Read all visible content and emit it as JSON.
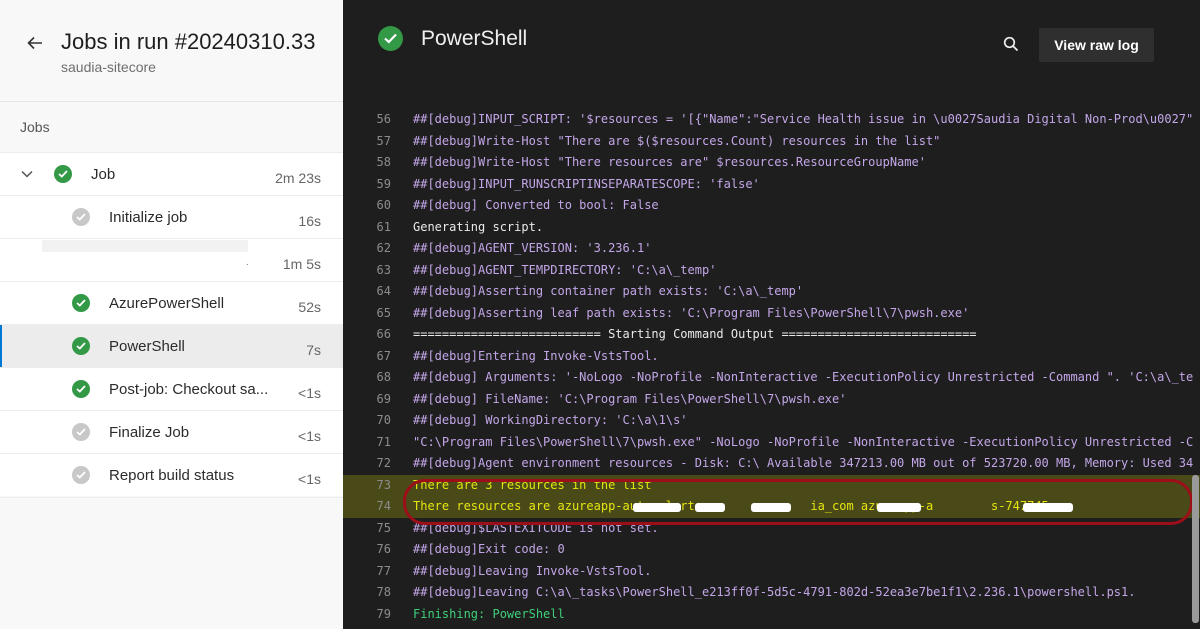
{
  "header": {
    "title": "Jobs in run #20240310.33",
    "subtitle": "saudia-sitecore",
    "back_icon": "arrow-left-icon"
  },
  "jobs_label": "Jobs",
  "jobs": [
    {
      "label": "Job",
      "duration": "2m 23s",
      "status": "success",
      "expanded": true
    },
    {
      "label": "Initialize job",
      "duration": "16s",
      "status": "pending"
    },
    {
      "label": "",
      "duration": "1m 5s",
      "status": "none"
    },
    {
      "label": "AzurePowerShell",
      "duration": "52s",
      "status": "success"
    },
    {
      "label": "PowerShell",
      "duration": "7s",
      "status": "success",
      "selected": true
    },
    {
      "label": "Post-job: Checkout sa...",
      "duration": "<1s",
      "status": "success"
    },
    {
      "label": "Finalize Job",
      "duration": "<1s",
      "status": "pending"
    },
    {
      "label": "Report build status",
      "duration": "<1s",
      "status": "pending"
    }
  ],
  "detail": {
    "title": "PowerShell",
    "status": "success",
    "search_icon": "search-icon",
    "view_raw_label": "View raw log"
  },
  "log_lines": [
    {
      "n": "56",
      "t": "##[debug]INPUT_SCRIPT: '$resources = '[{\"Name\":\"Service Health issue in \\u0027Saudia Digital Non-Prod\\u0027\"",
      "c": "debug"
    },
    {
      "n": "57",
      "t": "##[debug]Write-Host \"There are $($resources.Count) resources in the list\"",
      "c": "debug"
    },
    {
      "n": "58",
      "t": "##[debug]Write-Host \"There resources are\" $resources.ResourceGroupName'",
      "c": "debug"
    },
    {
      "n": "59",
      "t": "##[debug]INPUT_RUNSCRIPTINSEPARATESCOPE: 'false'",
      "c": "debug"
    },
    {
      "n": "60",
      "t": "##[debug] Converted to bool: False",
      "c": "debug"
    },
    {
      "n": "61",
      "t": "Generating script.",
      "c": ""
    },
    {
      "n": "62",
      "t": "##[debug]AGENT_VERSION: '3.236.1'",
      "c": "debug"
    },
    {
      "n": "63",
      "t": "##[debug]AGENT_TEMPDIRECTORY: 'C:\\a\\_temp'",
      "c": "debug"
    },
    {
      "n": "64",
      "t": "##[debug]Asserting container path exists: 'C:\\a\\_temp'",
      "c": "debug"
    },
    {
      "n": "65",
      "t": "##[debug]Asserting leaf path exists: 'C:\\Program Files\\PowerShell\\7\\pwsh.exe'",
      "c": "debug"
    },
    {
      "n": "66",
      "t": "========================== Starting Command Output ===========================",
      "c": ""
    },
    {
      "n": "67",
      "t": "##[debug]Entering Invoke-VstsTool.",
      "c": "debug"
    },
    {
      "n": "68",
      "t": "##[debug] Arguments: '-NoLogo -NoProfile -NonInteractive -ExecutionPolicy Unrestricted -Command \". 'C:\\a\\_te",
      "c": "debug"
    },
    {
      "n": "69",
      "t": "##[debug] FileName: 'C:\\Program Files\\PowerShell\\7\\pwsh.exe'",
      "c": "debug"
    },
    {
      "n": "70",
      "t": "##[debug] WorkingDirectory: 'C:\\a\\1\\s'",
      "c": "debug"
    },
    {
      "n": "71",
      "t": "\"C:\\Program Files\\PowerShell\\7\\pwsh.exe\" -NoLogo -NoProfile -NonInteractive -ExecutionPolicy Unrestricted -C",
      "c": "debug"
    },
    {
      "n": "72",
      "t": "##[debug]Agent environment resources - Disk: C:\\ Available 347213.00 MB out of 523720.00 MB, Memory: Used 34",
      "c": "debug"
    },
    {
      "n": "73",
      "t": "There are 3 resources in the list",
      "c": "warn"
    },
    {
      "n": "74",
      "t": "There resources are azureapp-auto-alerts-              ia_com azureapp-a        s-747745-",
      "c": "warn"
    },
    {
      "n": "75",
      "t": "##[debug]$LASTEXITCODE is not set.",
      "c": "debug"
    },
    {
      "n": "76",
      "t": "##[debug]Exit code: 0",
      "c": "debug"
    },
    {
      "n": "77",
      "t": "##[debug]Leaving Invoke-VstsTool.",
      "c": "debug"
    },
    {
      "n": "78",
      "t": "##[debug]Leaving C:\\a\\_tasks\\PowerShell_e213ff0f-5d5c-4791-802d-52ea3e7be1f1\\2.236.1\\powershell.ps1.",
      "c": "debug"
    },
    {
      "n": "79",
      "t": "Finishing: PowerShell",
      "c": "green"
    }
  ],
  "colors": {
    "success": "#339947",
    "pending": "#c8c8c8",
    "debug_text": "#c3a6e8",
    "warn_text": "#e5e510",
    "annotation": "#9c0f18"
  }
}
